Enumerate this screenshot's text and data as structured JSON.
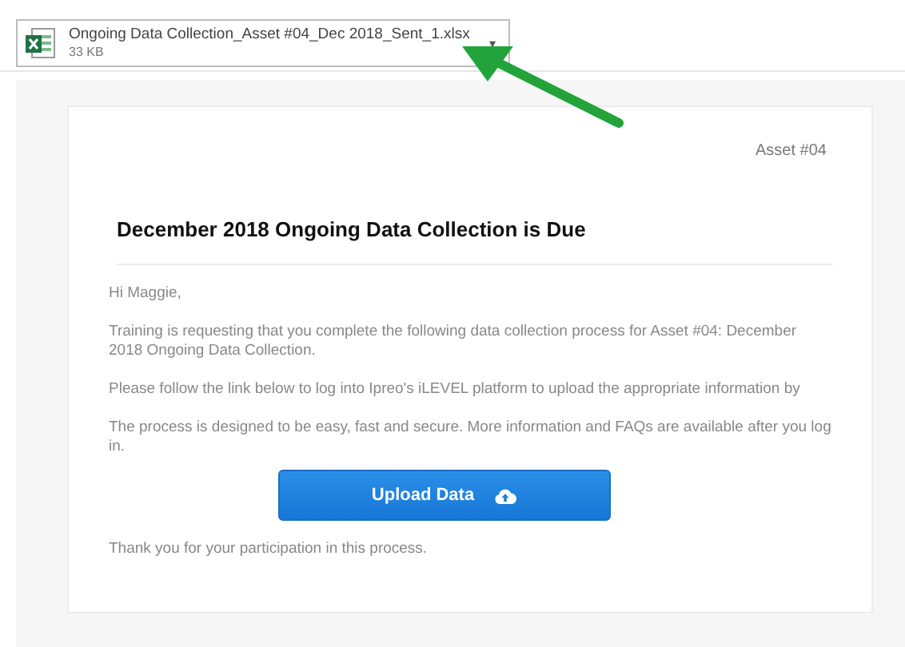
{
  "attachment": {
    "file_name": "Ongoing Data Collection_Asset #04_Dec 2018_Sent_1.xlsx",
    "size": "33 KB",
    "menu_glyph": "▾"
  },
  "email": {
    "asset_label": "Asset #04",
    "title": "December 2018 Ongoing Data Collection is Due",
    "paragraphs": [
      "Hi Maggie,",
      "Training is requesting that you complete the following data collection process for Asset #04: December 2018 Ongoing Data Collection.",
      "Please follow the link below to log into Ipreo's iLEVEL platform to upload the appropriate information by",
      "The process is designed to be easy, fast and secure. More information and FAQs are available after you log in."
    ],
    "button": "Upload Data",
    "closing": "Thank you for your participation in this process."
  }
}
